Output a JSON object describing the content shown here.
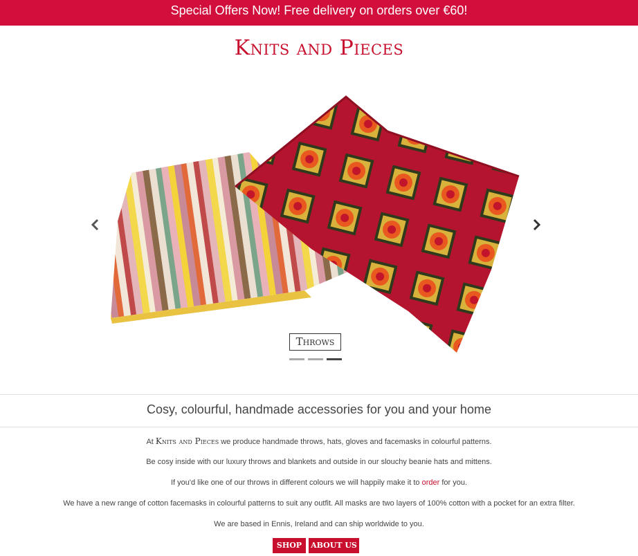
{
  "promo": {
    "text": "Special Offers Now! Free delivery on orders over €60!"
  },
  "site": {
    "title": "Knits and Pieces"
  },
  "carousel": {
    "caption": "Throws",
    "prev_icon": "chevron-left-icon",
    "next_icon": "chevron-right-icon",
    "slide_count": 3,
    "active_slide": 3
  },
  "tagline": "Cosy, colourful, handmade accessories for you and your home",
  "intro": {
    "p1_before": "At ",
    "p1_brand": "Knits and Pieces",
    "p1_after": " we produce handmade throws, hats, gloves and facemasks in colourful patterns.",
    "p2": "Be cosy inside with our luxury throws and blankets and outside in our slouchy beanie hats and mittens.",
    "p3_before": "If you'd like one of our throws in different colours we will happily make it to ",
    "p3_link": "order",
    "p3_after": " for you.",
    "p4": "We have a new range of cotton facemasks in colourful patterns to suit any outfit. All masks are two layers of 100% cotton with a pocket for an extra filter.",
    "p5": "We are based in Ennis, Ireland and can ship worldwide to you."
  },
  "buttons": {
    "shop": "SHOP",
    "about": "ABOUT US"
  },
  "colors": {
    "accent": "#c8102e",
    "promo_bg": "#d20f3c"
  }
}
